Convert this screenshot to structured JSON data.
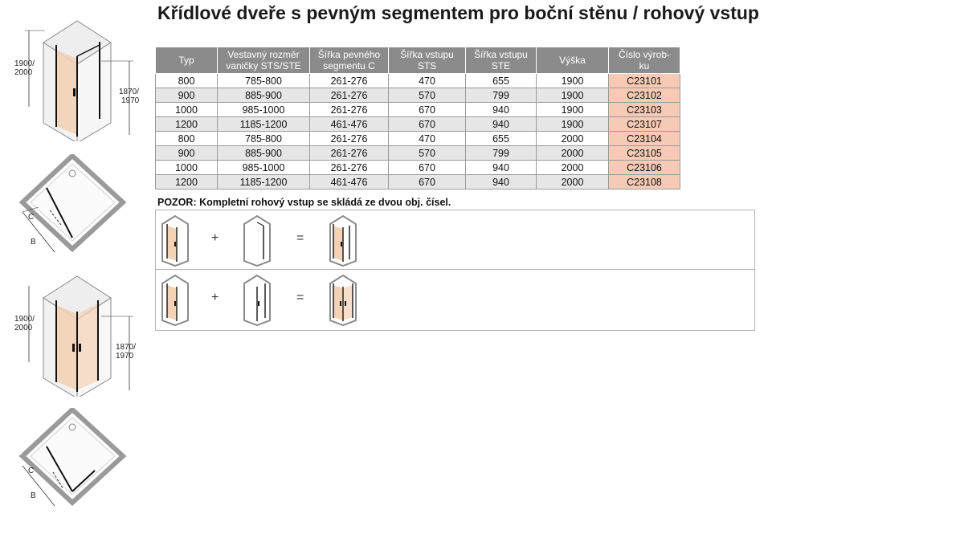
{
  "title": "Křídlové dveře s pevným segmentem pro boční stěnu / rohový vstup",
  "diagram_labels": {
    "height_outer": [
      "1900/",
      "2000"
    ],
    "height_inner": [
      "1870/",
      "1970"
    ],
    "dim_c": "C",
    "dim_b": "B"
  },
  "table": {
    "headers": [
      [
        "Typ"
      ],
      [
        "Vestavný rozměr",
        "vaničky STS/STE"
      ],
      [
        "Šířka pevného",
        "segmentu C"
      ],
      [
        "Šířka vstupu",
        "STS"
      ],
      [
        "Šířka vstupu",
        "STE"
      ],
      [
        "Výška"
      ],
      [
        "Číslo výrob-",
        "ku"
      ]
    ],
    "rows": [
      [
        "800",
        "785-800",
        "261-276",
        "470",
        "655",
        "1900",
        "C23101"
      ],
      [
        "900",
        "885-900",
        "261-276",
        "570",
        "799",
        "1900",
        "C23102"
      ],
      [
        "1000",
        "985-1000",
        "261-276",
        "670",
        "940",
        "1900",
        "C23103"
      ],
      [
        "1200",
        "1185-1200",
        "461-476",
        "670",
        "940",
        "1900",
        "C23107"
      ],
      [
        "800",
        "785-800",
        "261-276",
        "470",
        "655",
        "2000",
        "C23104"
      ],
      [
        "900",
        "885-900",
        "261-276",
        "570",
        "799",
        "2000",
        "C23105"
      ],
      [
        "1000",
        "985-1000",
        "261-276",
        "670",
        "940",
        "2000",
        "C23106"
      ],
      [
        "1200",
        "1185-1200",
        "461-476",
        "670",
        "940",
        "2000",
        "C23108"
      ]
    ]
  },
  "note": "POZOR: Kompletní rohový vstup se skládá ze dvou obj. čísel.",
  "combos": {
    "plus": "+",
    "equals": "="
  },
  "colors": {
    "header_bg": "#8b8b8b",
    "code_bg": "#f6cab4",
    "glass_tint": "#f3d2b5"
  }
}
